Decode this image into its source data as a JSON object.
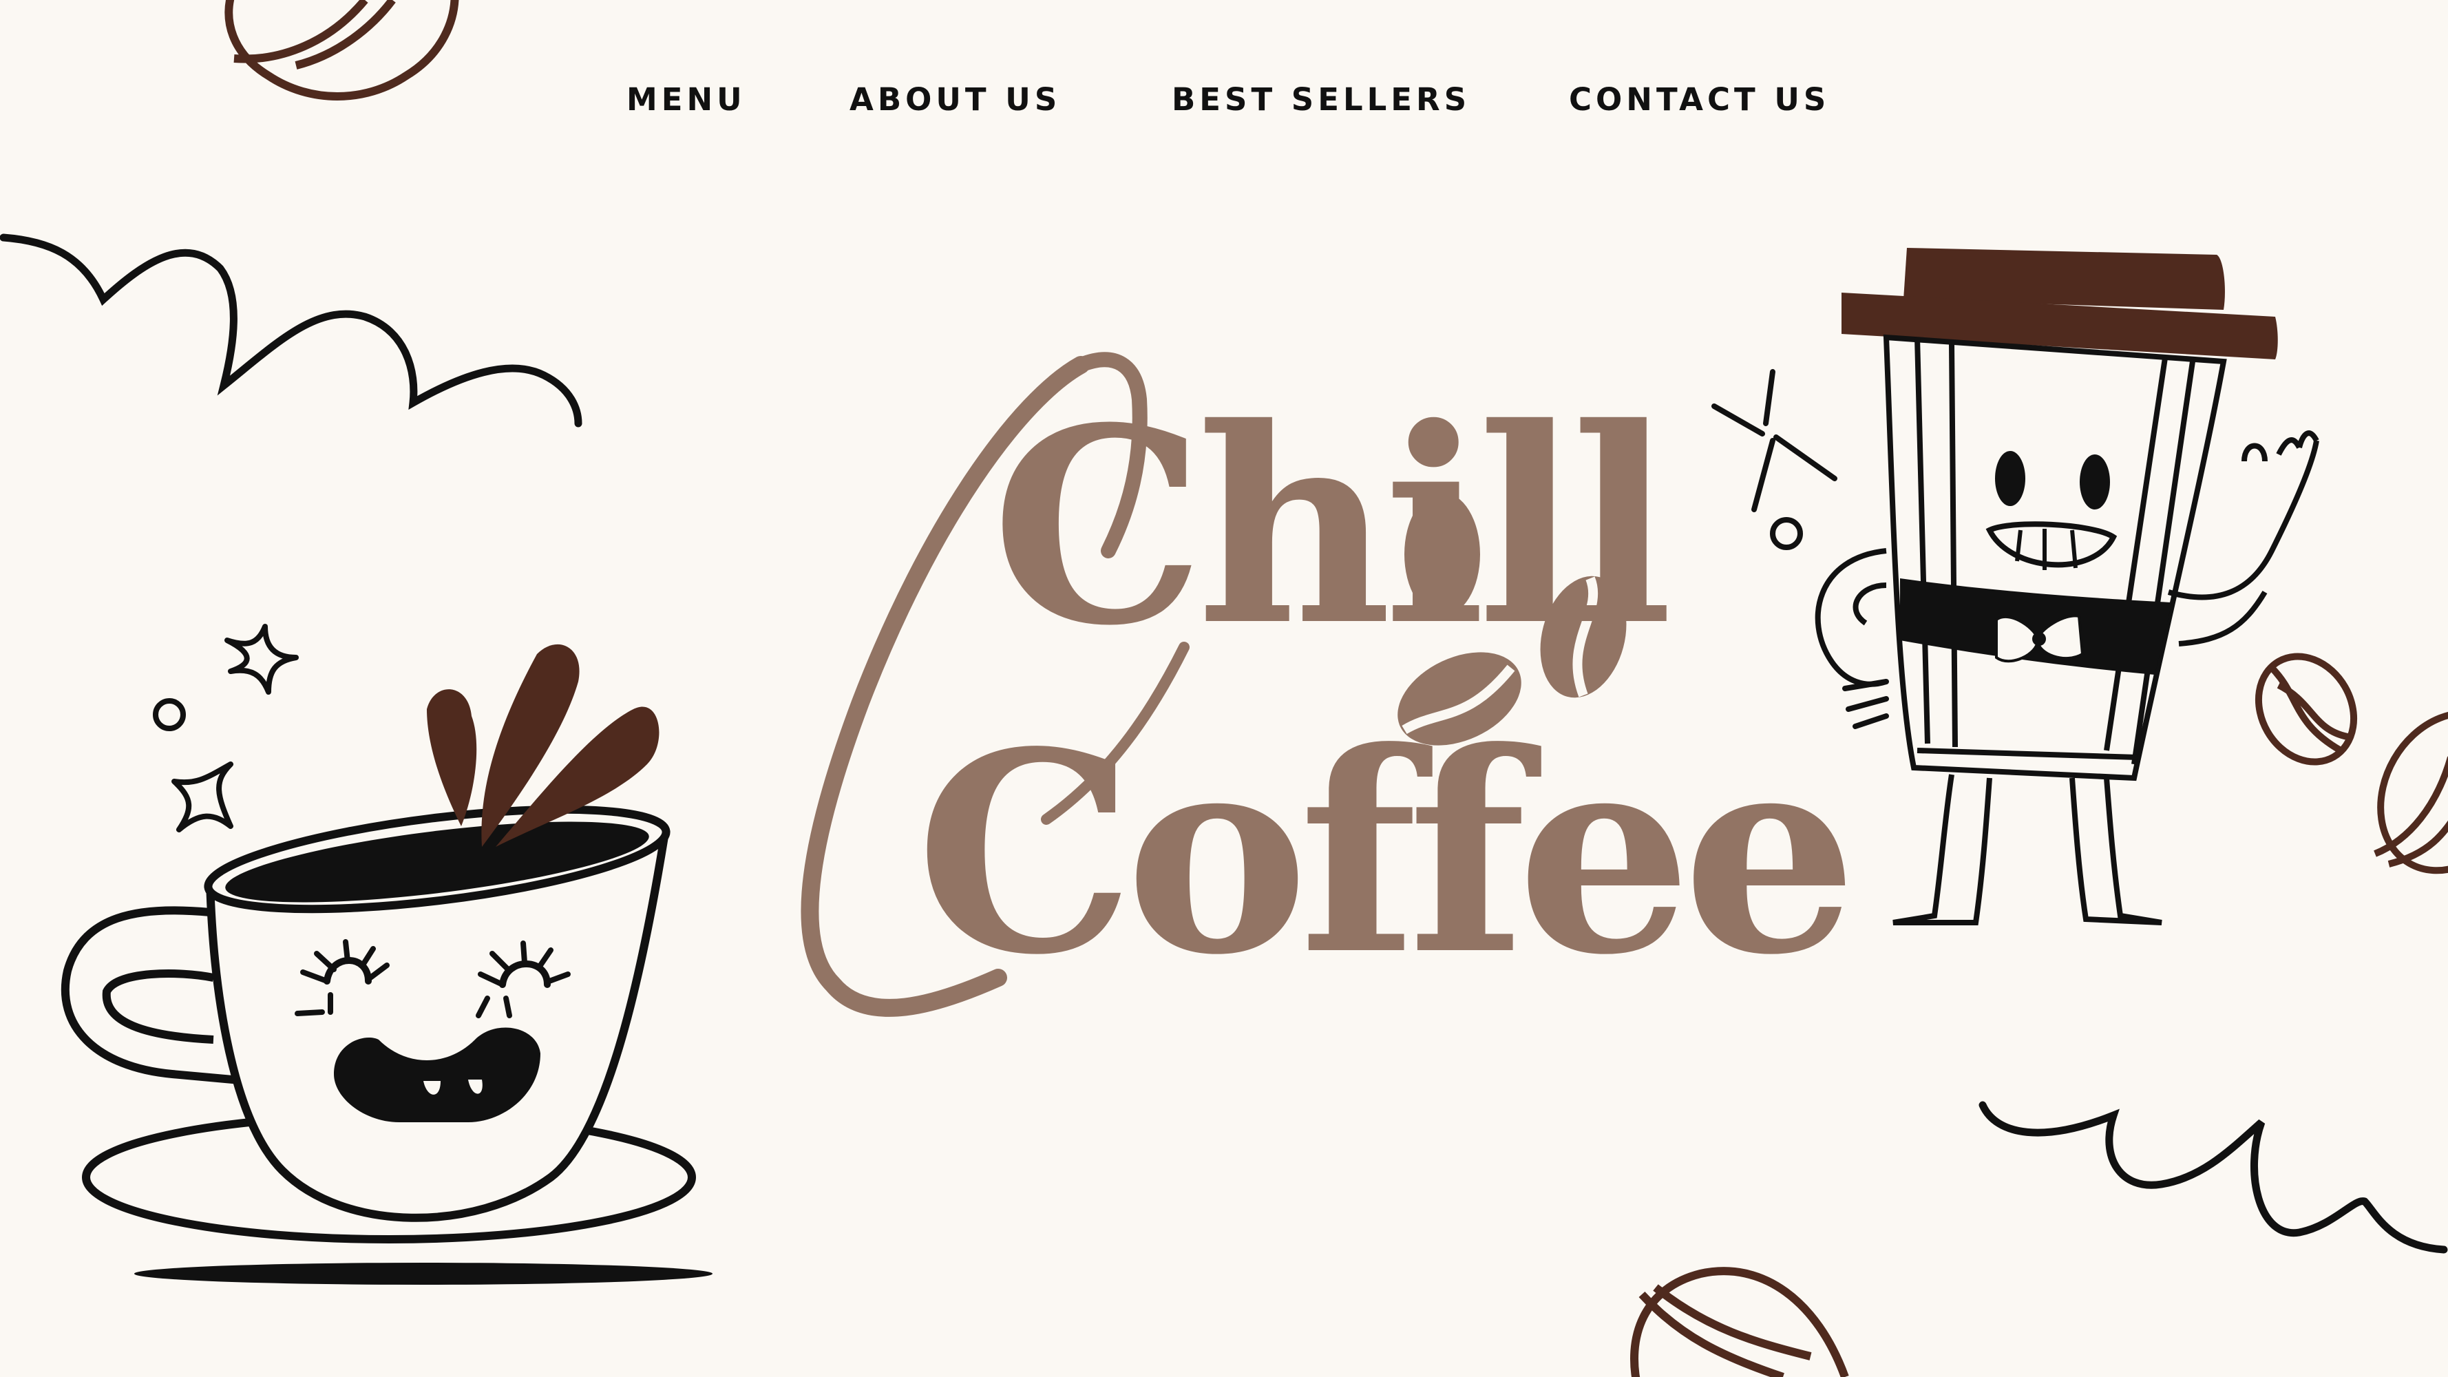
{
  "nav": {
    "menu": "MENU",
    "about": "ABOUT US",
    "best_sellers": "BEST SELLERS",
    "contact": "CONTACT US"
  },
  "hero": {
    "title_line1": "Chill",
    "title_line2": "Coffee"
  },
  "colors": {
    "background": "#FBF8F3",
    "title": "#927464",
    "dark_brown": "#4F2A1E",
    "outline": "#111111"
  }
}
